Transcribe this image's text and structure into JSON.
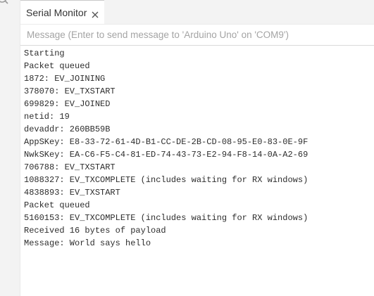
{
  "tab": {
    "label": "Serial Monitor",
    "close_icon": "close-icon"
  },
  "message": {
    "placeholder": "Message (Enter to send message to 'Arduino Uno' on 'COM9')",
    "value": ""
  },
  "output_lines": [
    "Starting",
    "Packet queued",
    "1872: EV_JOINING",
    "378070: EV_TXSTART",
    "699829: EV_JOINED",
    "netid: 19",
    "devaddr: 260BB59B",
    "AppSKey: E8-33-72-61-4D-B1-CC-DE-2B-CD-08-95-E0-83-0E-9F",
    "NwkSKey: EA-C6-F5-C4-81-ED-74-43-73-E2-94-F8-14-0A-A2-69",
    "706788: EV_TXSTART",
    "1088327: EV_TXCOMPLETE (includes waiting for RX windows)",
    "4838893: EV_TXSTART",
    "Packet queued",
    "5160153: EV_TXCOMPLETE (includes waiting for RX windows)",
    "Received 16 bytes of payload",
    "Message: World says hello"
  ],
  "colors": {
    "panel_background": "#f3f3f3",
    "text": "#2d2d2d",
    "placeholder": "#a4a4a4"
  }
}
